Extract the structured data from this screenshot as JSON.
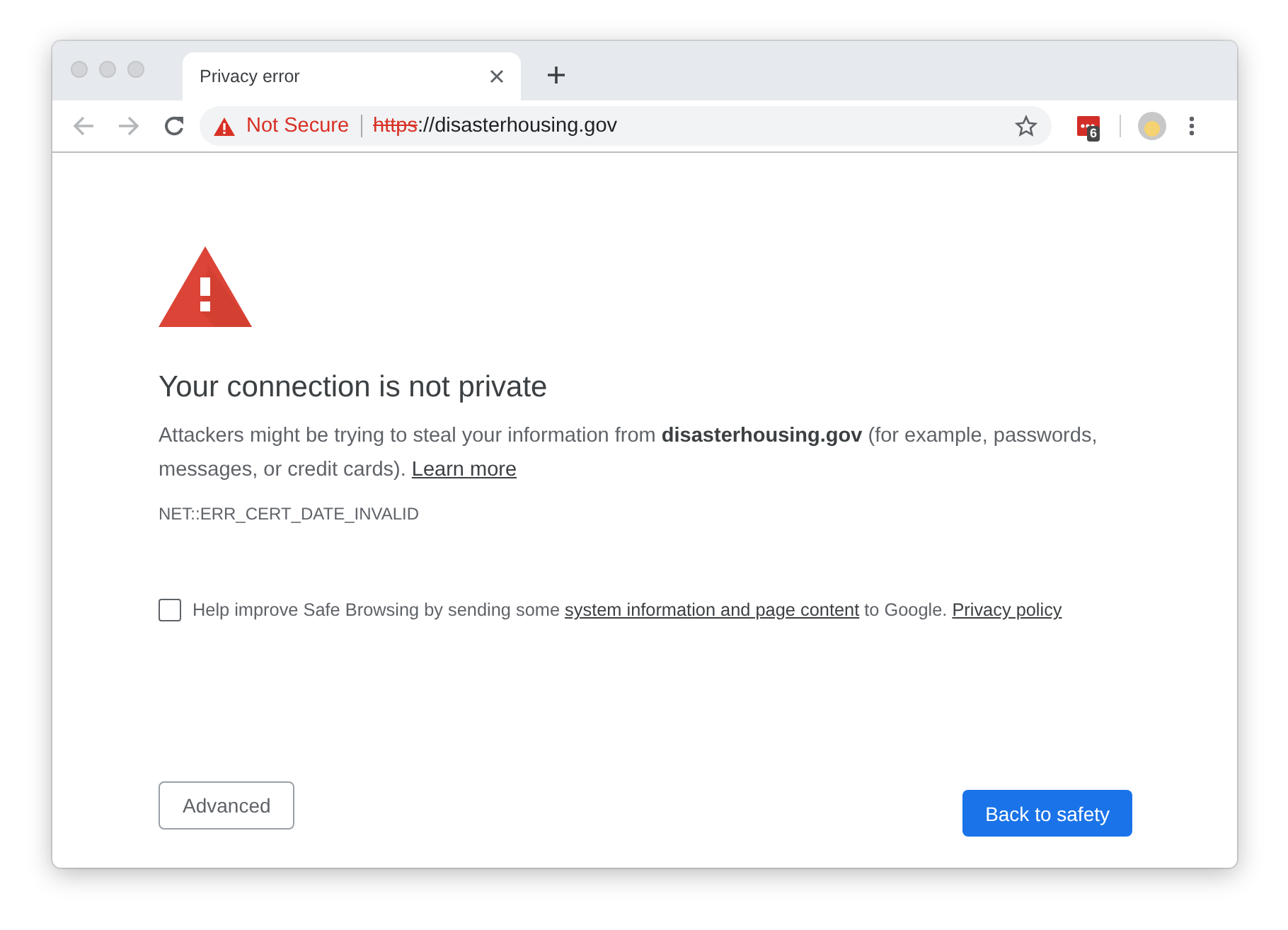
{
  "tabs": [
    {
      "label": "Privacy error",
      "selected": true
    }
  ],
  "address_bar": {
    "security_label": "Not Secure",
    "url_scheme": "https",
    "url_rest": "://disasterhousing.gov",
    "bookmarked": false
  },
  "extension_badge": "6",
  "page": {
    "heading": "Your connection is not private",
    "paragraph": [
      {
        "kind": "text",
        "text": "Attackers might be trying to steal your information from **disasterhousing.gov** (for example, passwords, messages, or credit cards). "
      },
      {
        "kind": "link",
        "text": "Learn more"
      }
    ],
    "error_code": "NET::ERR_CERT_DATE_INVALID",
    "safe_browsing": {
      "checked": false,
      "parts": [
        {
          "kind": "text",
          "text": "Help improve Safe Browsing by sending some "
        },
        {
          "kind": "link",
          "text": "system information and page content"
        },
        {
          "kind": "text",
          "text": " to Google. "
        },
        {
          "kind": "link",
          "text": "Privacy policy"
        }
      ]
    },
    "buttons": [
      {
        "label": "Advanced",
        "kind": "secondary"
      },
      {
        "label": "Back to safety",
        "kind": "primary"
      }
    ]
  }
}
